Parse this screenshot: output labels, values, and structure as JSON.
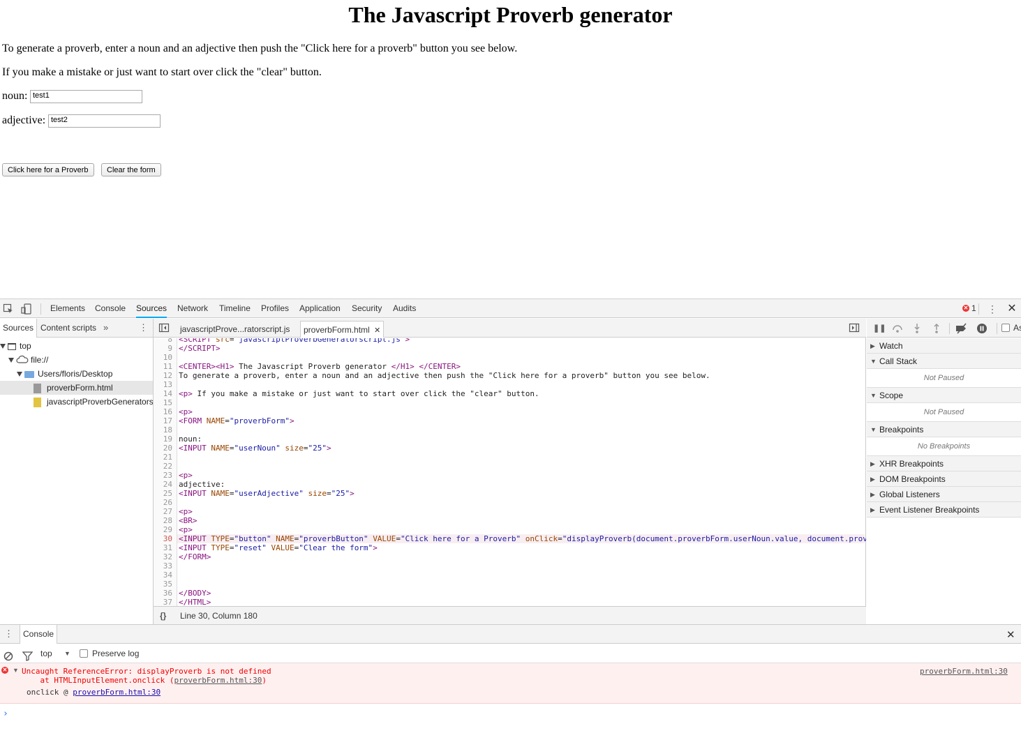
{
  "page": {
    "heading": "The Javascript Proverb generator",
    "intro": "To generate a proverb, enter a noun and an adjective then push the \"Click here for a proverb\" button you see below.",
    "instruction": "If you make a mistake or just want to start over click the \"clear\" button.",
    "noun_label": "noun:",
    "noun_value": "test1",
    "adjective_label": "adjective:",
    "adjective_value": "test2",
    "proverb_button": "Click here for a Proverb",
    "clear_button": "Clear the form"
  },
  "devtools": {
    "tabs": [
      "Elements",
      "Console",
      "Sources",
      "Network",
      "Timeline",
      "Profiles",
      "Application",
      "Security",
      "Audits"
    ],
    "active_tab": "Sources",
    "error_count": "1",
    "navigator": {
      "tabs": [
        "Sources",
        "Content scripts"
      ],
      "tree": {
        "top": "top",
        "origin": "file://",
        "folder": "Users/floris/Desktop",
        "file1": "proverbForm.html",
        "file2": "javascriptProverbGeneratorscript.js"
      }
    },
    "editor": {
      "tab1": "javascriptProve...ratorscript.js",
      "tab2": "proverbForm.html",
      "status": "Line 30, Column 180",
      "format_icon": "{}"
    },
    "sidebar": {
      "watch": "Watch",
      "call_stack": "Call Stack",
      "call_stack_body": "Not Paused",
      "scope": "Scope",
      "scope_body": "Not Paused",
      "breakpoints": "Breakpoints",
      "breakpoints_body": "No Breakpoints",
      "xhr": "XHR Breakpoints",
      "dom": "DOM Breakpoints",
      "global": "Global Listeners",
      "event": "Event Listener Breakpoints",
      "async_label": "As"
    },
    "console": {
      "tab": "Console",
      "context": "top",
      "preserve_log": "Preserve log",
      "error_line1": "Uncaught ReferenceError: displayProverb is not defined",
      "error_line2_prefix": "    at HTMLInputElement.onclick (",
      "error_line2_link": "proverbForm.html:30",
      "error_line2_suffix": ")",
      "error_source": "proverbForm.html:30",
      "stack_fn": "onclick @ ",
      "stack_link": "proverbForm.html:30"
    }
  }
}
